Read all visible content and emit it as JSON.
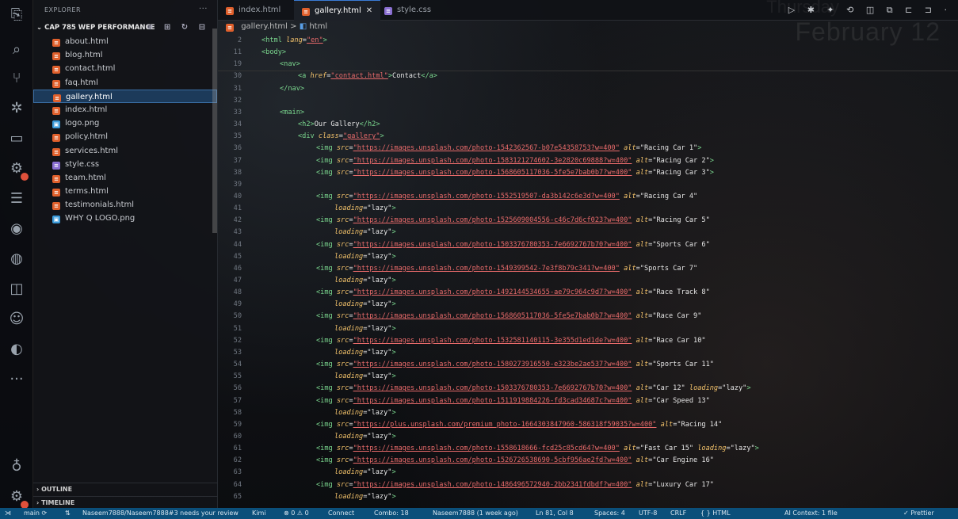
{
  "explorer": {
    "title": "EXPLORER",
    "more": "···",
    "project": "CAP 785 WEP PERFORMANCE",
    "project_actions": "⊕ ⊞ ↻ ⊟",
    "files": [
      {
        "name": "about.html",
        "type": "html"
      },
      {
        "name": "blog.html",
        "type": "html"
      },
      {
        "name": "contact.html",
        "type": "html"
      },
      {
        "name": "faq.html",
        "type": "html"
      },
      {
        "name": "gallery.html",
        "type": "html",
        "active": true
      },
      {
        "name": "index.html",
        "type": "html"
      },
      {
        "name": "logo.png",
        "type": "image"
      },
      {
        "name": "policy.html",
        "type": "html"
      },
      {
        "name": "services.html",
        "type": "html"
      },
      {
        "name": "style.css",
        "type": "css"
      },
      {
        "name": "team.html",
        "type": "html"
      },
      {
        "name": "terms.html",
        "type": "html"
      },
      {
        "name": "testimonials.html",
        "type": "html"
      },
      {
        "name": "WHY Q LOGO.png",
        "type": "image"
      }
    ],
    "outline": "OUTLINE",
    "timeline": "TIMELINE"
  },
  "tabs": [
    {
      "label": "index.html",
      "active": false
    },
    {
      "label": "gallery.html",
      "active": true,
      "close": "✕"
    },
    {
      "label": "style.css",
      "active": false
    }
  ],
  "watermark": {
    "day": "Thursday",
    "date": "February 12"
  },
  "top_actions": "▷ ✱ ✦ ⟲ ◫ ⧉ ⊏ ⊐ ·",
  "breadcrumb": {
    "file": "gallery.html",
    "sep": ">",
    "node": "html"
  },
  "code_lines": [
    {
      "n": "2",
      "parts": [
        [
          "t",
          "<html "
        ],
        [
          "a",
          "lang"
        ],
        [
          "p",
          "="
        ],
        [
          "s",
          "\"en\""
        ],
        [
          "t",
          ">"
        ]
      ],
      "indent": 0
    },
    {
      "n": "11",
      "parts": [
        [
          "t",
          "<body>"
        ]
      ],
      "indent": 0
    },
    {
      "n": "19",
      "parts": [
        [
          "t",
          "<nav>"
        ]
      ],
      "indent": 1
    },
    {
      "n": "30",
      "parts": [
        [
          "t",
          "<a "
        ],
        [
          "a",
          "href"
        ],
        [
          "p",
          "="
        ],
        [
          "s",
          "\"contact.html\""
        ],
        [
          "t",
          ">"
        ],
        [
          "p",
          "Contact"
        ],
        [
          "t",
          "</a>"
        ]
      ],
      "indent": 2
    },
    {
      "n": "31",
      "parts": [
        [
          "t",
          "</nav>"
        ]
      ],
      "indent": 1
    },
    {
      "n": "32",
      "parts": [],
      "indent": 0
    },
    {
      "n": "33",
      "parts": [
        [
          "t",
          "<main>"
        ]
      ],
      "indent": 1
    },
    {
      "n": "34",
      "parts": [
        [
          "t",
          "<h2>"
        ],
        [
          "p",
          "Our Gallery"
        ],
        [
          "t",
          "</h2>"
        ]
      ],
      "indent": 2
    },
    {
      "n": "35",
      "parts": [
        [
          "t",
          "<div "
        ],
        [
          "a",
          "class"
        ],
        [
          "p",
          "="
        ],
        [
          "s",
          "\"gallery\""
        ],
        [
          "t",
          ">"
        ]
      ],
      "indent": 2
    },
    {
      "n": "36",
      "parts": [
        [
          "t",
          "<img "
        ],
        [
          "a",
          "src"
        ],
        [
          "p",
          "="
        ],
        [
          "s",
          "\"https://images.unsplash.com/photo-1542362567-b07e54358753?w=400\""
        ],
        [
          "p",
          " "
        ],
        [
          "a",
          "alt"
        ],
        [
          "p",
          "=\"Racing Car 1\""
        ],
        [
          "t",
          ">"
        ]
      ],
      "indent": 3
    },
    {
      "n": "37",
      "parts": [
        [
          "t",
          "<img "
        ],
        [
          "a",
          "src"
        ],
        [
          "p",
          "="
        ],
        [
          "s",
          "\"https://images.unsplash.com/photo-1583121274602-3e2820c69888?w=400\""
        ],
        [
          "p",
          " "
        ],
        [
          "a",
          "alt"
        ],
        [
          "p",
          "=\"Racing Car 2\""
        ],
        [
          "t",
          ">"
        ]
      ],
      "indent": 3
    },
    {
      "n": "38",
      "parts": [
        [
          "t",
          "<img "
        ],
        [
          "a",
          "src"
        ],
        [
          "p",
          "="
        ],
        [
          "s",
          "\"https://images.unsplash.com/photo-1568605117036-5fe5e7bab0b7?w=400\""
        ],
        [
          "p",
          " "
        ],
        [
          "a",
          "alt"
        ],
        [
          "p",
          "=\"Racing Car 3\""
        ],
        [
          "t",
          ">"
        ]
      ],
      "indent": 3
    },
    {
      "n": "39",
      "parts": [],
      "indent": 0
    },
    {
      "n": "40",
      "parts": [
        [
          "t",
          "<img "
        ],
        [
          "a",
          "src"
        ],
        [
          "p",
          "="
        ],
        [
          "s",
          "\"https://images.unsplash.com/photo-1552519507-da3b142c6e3d?w=400\""
        ],
        [
          "p",
          " "
        ],
        [
          "a",
          "alt"
        ],
        [
          "p",
          "=\"Racing Car 4\""
        ]
      ],
      "indent": 3
    },
    {
      "n": "41",
      "parts": [
        [
          "a",
          "loading"
        ],
        [
          "p",
          "=\"lazy\""
        ],
        [
          "t",
          ">"
        ]
      ],
      "indent": 4
    },
    {
      "n": "42",
      "parts": [
        [
          "t",
          "<img "
        ],
        [
          "a",
          "src"
        ],
        [
          "p",
          "="
        ],
        [
          "s",
          "\"https://images.unsplash.com/photo-1525609004556-c46c7d6cf023?w=400\""
        ],
        [
          "p",
          " "
        ],
        [
          "a",
          "alt"
        ],
        [
          "p",
          "=\"Racing Car 5\""
        ]
      ],
      "indent": 3
    },
    {
      "n": "43",
      "parts": [
        [
          "a",
          "loading"
        ],
        [
          "p",
          "=\"lazy\""
        ],
        [
          "t",
          ">"
        ]
      ],
      "indent": 4
    },
    {
      "n": "44",
      "parts": [
        [
          "t",
          "<img "
        ],
        [
          "a",
          "src"
        ],
        [
          "p",
          "="
        ],
        [
          "s",
          "\"https://images.unsplash.com/photo-1503376780353-7e6692767b70?w=400\""
        ],
        [
          "p",
          " "
        ],
        [
          "a",
          "alt"
        ],
        [
          "p",
          "=\"Sports Car 6\""
        ]
      ],
      "indent": 3
    },
    {
      "n": "45",
      "parts": [
        [
          "a",
          "loading"
        ],
        [
          "p",
          "=\"lazy\""
        ],
        [
          "t",
          ">"
        ]
      ],
      "indent": 4
    },
    {
      "n": "46",
      "parts": [
        [
          "t",
          "<img "
        ],
        [
          "a",
          "src"
        ],
        [
          "p",
          "="
        ],
        [
          "s",
          "\"https://images.unsplash.com/photo-1549399542-7e3f8b79c341?w=400\""
        ],
        [
          "p",
          " "
        ],
        [
          "a",
          "alt"
        ],
        [
          "p",
          "=\"Sports Car 7\""
        ]
      ],
      "indent": 3
    },
    {
      "n": "47",
      "parts": [
        [
          "a",
          "loading"
        ],
        [
          "p",
          "=\"lazy\""
        ],
        [
          "t",
          ">"
        ]
      ],
      "indent": 4
    },
    {
      "n": "48",
      "parts": [
        [
          "t",
          "<img "
        ],
        [
          "a",
          "src"
        ],
        [
          "p",
          "="
        ],
        [
          "s",
          "\"https://images.unsplash.com/photo-1492144534655-ae79c964c9d7?w=400\""
        ],
        [
          "p",
          " "
        ],
        [
          "a",
          "alt"
        ],
        [
          "p",
          "=\"Race Track 8\""
        ]
      ],
      "indent": 3
    },
    {
      "n": "49",
      "parts": [
        [
          "a",
          "loading"
        ],
        [
          "p",
          "=\"lazy\""
        ],
        [
          "t",
          ">"
        ]
      ],
      "indent": 4
    },
    {
      "n": "50",
      "parts": [
        [
          "t",
          "<img "
        ],
        [
          "a",
          "src"
        ],
        [
          "p",
          "="
        ],
        [
          "s",
          "\"https://images.unsplash.com/photo-1568605117036-5fe5e7bab0b7?w=400\""
        ],
        [
          "p",
          " "
        ],
        [
          "a",
          "alt"
        ],
        [
          "p",
          "=\"Race Car 9\""
        ]
      ],
      "indent": 3
    },
    {
      "n": "51",
      "parts": [
        [
          "a",
          "loading"
        ],
        [
          "p",
          "=\"lazy\""
        ],
        [
          "t",
          ">"
        ]
      ],
      "indent": 4
    },
    {
      "n": "52",
      "parts": [
        [
          "t",
          "<img "
        ],
        [
          "a",
          "src"
        ],
        [
          "p",
          "="
        ],
        [
          "s",
          "\"https://images.unsplash.com/photo-1532581140115-3e355d1ed1de?w=400\""
        ],
        [
          "p",
          " "
        ],
        [
          "a",
          "alt"
        ],
        [
          "p",
          "=\"Race Car 10\""
        ]
      ],
      "indent": 3
    },
    {
      "n": "53",
      "parts": [
        [
          "a",
          "loading"
        ],
        [
          "p",
          "=\"lazy\""
        ],
        [
          "t",
          ">"
        ]
      ],
      "indent": 4
    },
    {
      "n": "54",
      "parts": [
        [
          "t",
          "<img "
        ],
        [
          "a",
          "src"
        ],
        [
          "p",
          "="
        ],
        [
          "s",
          "\"https://images.unsplash.com/photo-1580273916550-e323be2ae537?w=400\""
        ],
        [
          "p",
          " "
        ],
        [
          "a",
          "alt"
        ],
        [
          "p",
          "=\"Sports Car 11\""
        ]
      ],
      "indent": 3
    },
    {
      "n": "55",
      "parts": [
        [
          "a",
          "loading"
        ],
        [
          "p",
          "=\"lazy\""
        ],
        [
          "t",
          ">"
        ]
      ],
      "indent": 4
    },
    {
      "n": "56",
      "parts": [
        [
          "t",
          "<img "
        ],
        [
          "a",
          "src"
        ],
        [
          "p",
          "="
        ],
        [
          "s",
          "\"https://images.unsplash.com/photo-1503376780353-7e6692767b70?w=400\""
        ],
        [
          "p",
          " "
        ],
        [
          "a",
          "alt"
        ],
        [
          "p",
          "=\"Car 12\" "
        ],
        [
          "a",
          "loading"
        ],
        [
          "p",
          "=\"lazy\""
        ],
        [
          "t",
          ">"
        ]
      ],
      "indent": 3
    },
    {
      "n": "57",
      "parts": [
        [
          "t",
          "<img "
        ],
        [
          "a",
          "src"
        ],
        [
          "p",
          "="
        ],
        [
          "s",
          "\"https://images.unsplash.com/photo-1511919884226-fd3cad34687c?w=400\""
        ],
        [
          "p",
          " "
        ],
        [
          "a",
          "alt"
        ],
        [
          "p",
          "=\"Car Speed 13\""
        ]
      ],
      "indent": 3
    },
    {
      "n": "58",
      "parts": [
        [
          "a",
          "loading"
        ],
        [
          "p",
          "=\"lazy\""
        ],
        [
          "t",
          ">"
        ]
      ],
      "indent": 4
    },
    {
      "n": "59",
      "parts": [
        [
          "t",
          "<img "
        ],
        [
          "a",
          "src"
        ],
        [
          "p",
          "="
        ],
        [
          "s",
          "\"https://plus.unsplash.com/premium_photo-1664303847960-586318f59035?w=400\""
        ],
        [
          "p",
          " "
        ],
        [
          "a",
          "alt"
        ],
        [
          "p",
          "=\"Racing 14\""
        ]
      ],
      "indent": 3
    },
    {
      "n": "60",
      "parts": [
        [
          "a",
          "loading"
        ],
        [
          "p",
          "=\"lazy\""
        ],
        [
          "t",
          ">"
        ]
      ],
      "indent": 4
    },
    {
      "n": "61",
      "parts": [
        [
          "t",
          "<img "
        ],
        [
          "a",
          "src"
        ],
        [
          "p",
          "="
        ],
        [
          "s",
          "\"https://images.unsplash.com/photo-1558618666-fcd25c85cd64?w=400\""
        ],
        [
          "p",
          " "
        ],
        [
          "a",
          "alt"
        ],
        [
          "p",
          "=\"Fast Car 15\" "
        ],
        [
          "a",
          "loading"
        ],
        [
          "p",
          "=\"lazy\""
        ],
        [
          "t",
          ">"
        ]
      ],
      "indent": 3
    },
    {
      "n": "62",
      "parts": [
        [
          "t",
          "<img "
        ],
        [
          "a",
          "src"
        ],
        [
          "p",
          "="
        ],
        [
          "s",
          "\"https://images.unsplash.com/photo-1526726538690-5cbf956ae2fd?w=400\""
        ],
        [
          "p",
          " "
        ],
        [
          "a",
          "alt"
        ],
        [
          "p",
          "=\"Car Engine 16\""
        ]
      ],
      "indent": 3
    },
    {
      "n": "63",
      "parts": [
        [
          "a",
          "loading"
        ],
        [
          "p",
          "=\"lazy\""
        ],
        [
          "t",
          ">"
        ]
      ],
      "indent": 4
    },
    {
      "n": "64",
      "parts": [
        [
          "t",
          "<img "
        ],
        [
          "a",
          "src"
        ],
        [
          "p",
          "="
        ],
        [
          "s",
          "\"https://images.unsplash.com/photo-1486496572940-2bb2341fdbdf?w=400\""
        ],
        [
          "p",
          " "
        ],
        [
          "a",
          "alt"
        ],
        [
          "p",
          "=\"Luxury Car 17\""
        ]
      ],
      "indent": 3
    },
    {
      "n": "65",
      "parts": [
        [
          "a",
          "loading"
        ],
        [
          "p",
          "=\"lazy\""
        ],
        [
          "t",
          ">"
        ]
      ],
      "indent": 4
    }
  ],
  "statusbar": {
    "branch": "main ⟳",
    "review": "Naseem7888/Naseem7888#3 needs your review",
    "kimi": "Kimi",
    "problems": "⊗ 0 ⚠ 0",
    "connect": "Connect",
    "combo": "Combo: 18",
    "blame": "Naseem7888 (1 week ago)",
    "position": "Ln 81, Col 8",
    "spaces": "Spaces: 4",
    "encoding": "UTF-8",
    "eol": "CRLF",
    "language": "{ } HTML",
    "context": "AI Context: 1 file",
    "prettier": "✓ Prettier"
  },
  "colors": {
    "statusbar": "#0b4f7a",
    "tag": "#7bd88f",
    "attr": "#f4c36b",
    "string": "#e96b6b",
    "active_file_bg": "#1c3a5a"
  }
}
